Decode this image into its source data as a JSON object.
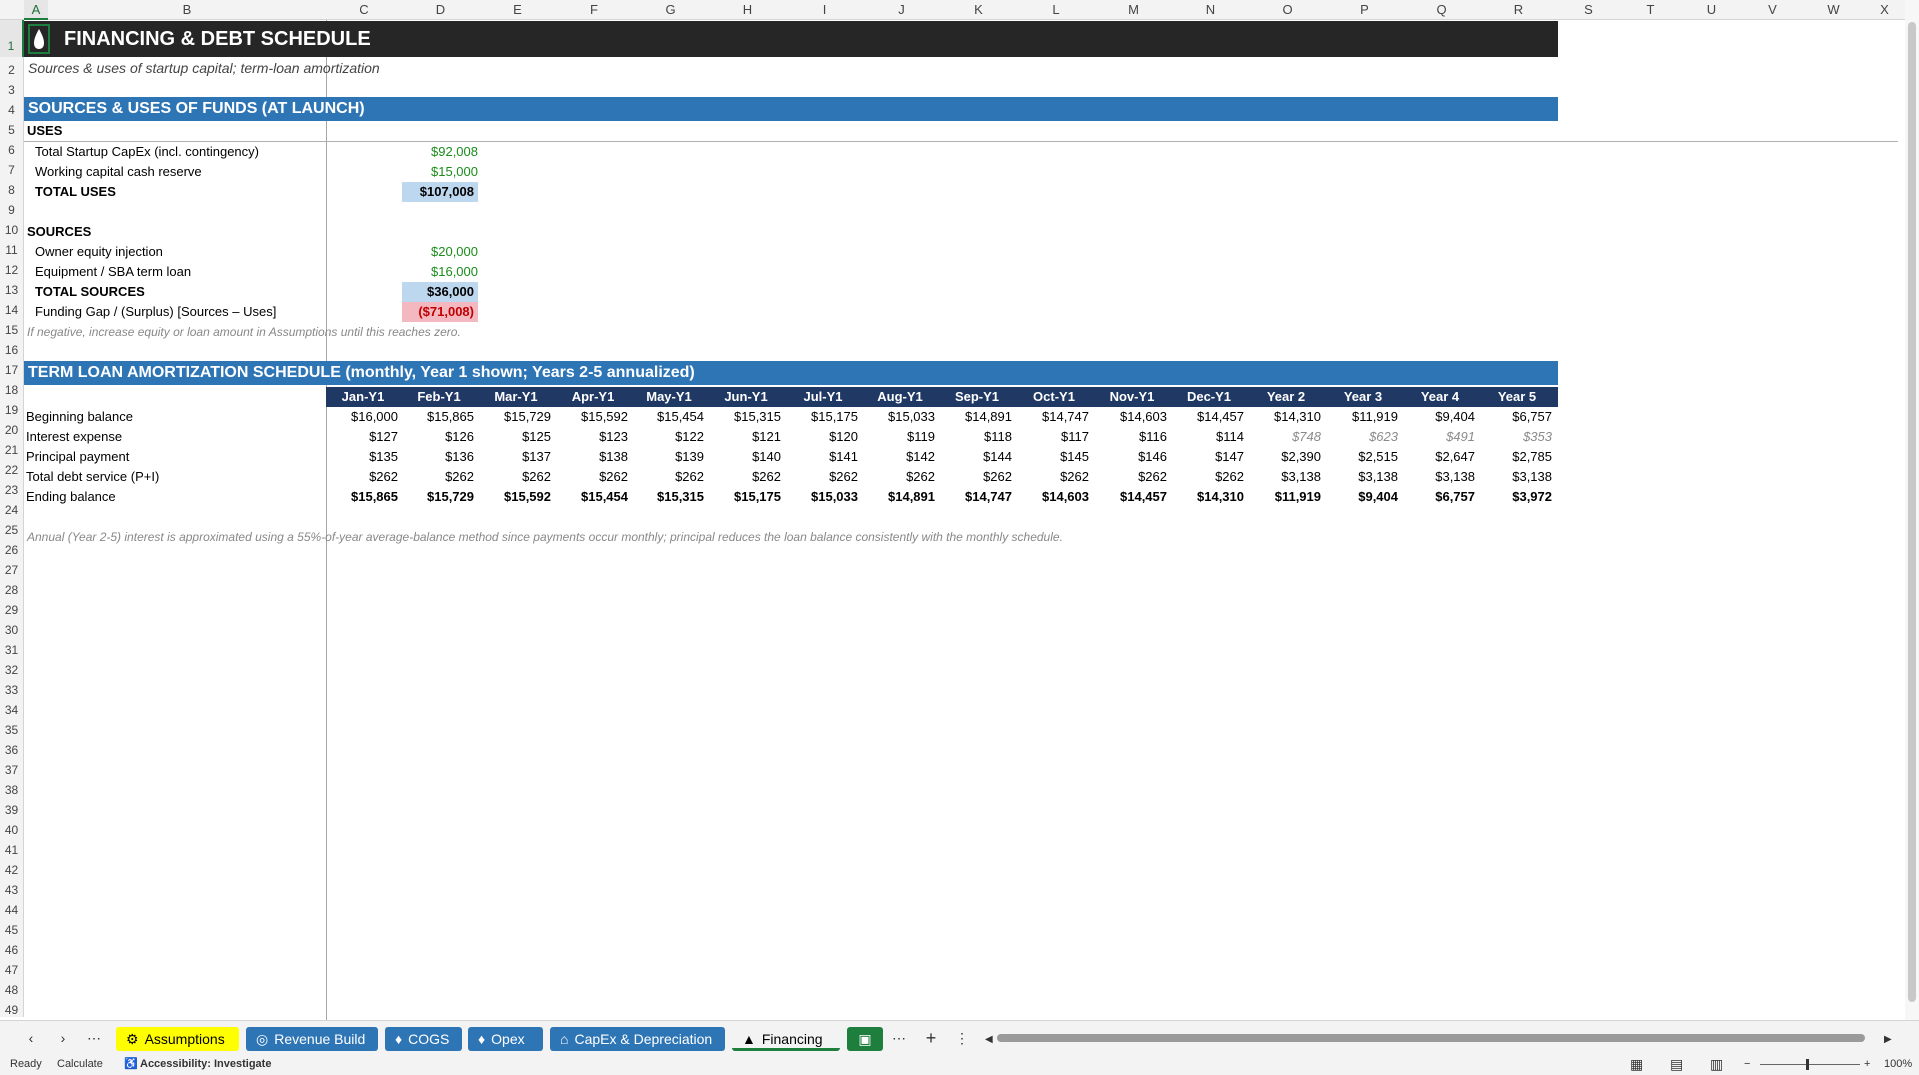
{
  "columns": [
    "A",
    "B",
    "C",
    "D",
    "E",
    "F",
    "G",
    "H",
    "I",
    "J",
    "K",
    "L",
    "M",
    "N",
    "O",
    "P",
    "Q",
    "R",
    "S",
    "T",
    "U",
    "V",
    "W",
    "X"
  ],
  "rows": [
    "1",
    "2",
    "3",
    "4",
    "5",
    "6",
    "7",
    "8",
    "9",
    "10",
    "11",
    "12",
    "13",
    "14",
    "15",
    "16",
    "17",
    "18",
    "19",
    "20",
    "21",
    "22",
    "23",
    "24",
    "25",
    "26",
    "27",
    "28",
    "29",
    "30",
    "31",
    "32",
    "33",
    "34",
    "35",
    "36",
    "37",
    "38",
    "39",
    "40",
    "41",
    "42",
    "43",
    "44",
    "45",
    "46",
    "47",
    "48",
    "49"
  ],
  "sheet": {
    "title": "FINANCING & DEBT SCHEDULE",
    "subtitle": "Sources & uses of startup capital; term-loan amortization",
    "sources_uses_header": "SOURCES & USES OF FUNDS (AT LAUNCH)",
    "uses_label": "USES",
    "uses": [
      {
        "label": "Total Startup CapEx (incl. contingency)",
        "value": "$92,008"
      },
      {
        "label": "Working capital cash reserve",
        "value": "$15,000"
      }
    ],
    "total_uses_label": "TOTAL USES",
    "total_uses_value": "$107,008",
    "sources_label": "SOURCES",
    "sources": [
      {
        "label": "Owner equity injection",
        "value": "$20,000"
      },
      {
        "label": "Equipment / SBA term loan",
        "value": "$16,000"
      }
    ],
    "total_sources_label": "TOTAL SOURCES",
    "total_sources_value": "$36,000",
    "gap_label": "Funding Gap / (Surplus)  [Sources – Uses]",
    "gap_value": "($71,008)",
    "gap_note": "If negative, increase equity or loan amount in Assumptions until this reaches zero.",
    "amort_header": "TERM LOAN AMORTIZATION SCHEDULE  (monthly, Year 1 shown; Years 2-5 annualized)",
    "periods": [
      "Jan-Y1",
      "Feb-Y1",
      "Mar-Y1",
      "Apr-Y1",
      "May-Y1",
      "Jun-Y1",
      "Jul-Y1",
      "Aug-Y1",
      "Sep-Y1",
      "Oct-Y1",
      "Nov-Y1",
      "Dec-Y1",
      "Year 2",
      "Year 3",
      "Year 4",
      "Year 5"
    ],
    "amort_rows": [
      {
        "label": "Beginning balance",
        "values": [
          "$16,000",
          "$15,865",
          "$15,729",
          "$15,592",
          "$15,454",
          "$15,315",
          "$15,175",
          "$15,033",
          "$14,891",
          "$14,747",
          "$14,603",
          "$14,457",
          "$14,310",
          "$11,919",
          "$9,404",
          "$6,757"
        ]
      },
      {
        "label": "Interest expense",
        "values": [
          "$127",
          "$126",
          "$125",
          "$123",
          "$122",
          "$121",
          "$120",
          "$119",
          "$118",
          "$117",
          "$116",
          "$114",
          "$748",
          "$623",
          "$491",
          "$353"
        ]
      },
      {
        "label": "Principal payment",
        "values": [
          "$135",
          "$136",
          "$137",
          "$138",
          "$139",
          "$140",
          "$141",
          "$142",
          "$144",
          "$145",
          "$146",
          "$147",
          "$2,390",
          "$2,515",
          "$2,647",
          "$2,785"
        ]
      },
      {
        "label": "Total debt service (P+I)",
        "values": [
          "$262",
          "$262",
          "$262",
          "$262",
          "$262",
          "$262",
          "$262",
          "$262",
          "$262",
          "$262",
          "$262",
          "$262",
          "$3,138",
          "$3,138",
          "$3,138",
          "$3,138"
        ]
      },
      {
        "label": "Ending balance",
        "values": [
          "$15,865",
          "$15,729",
          "$15,592",
          "$15,454",
          "$15,315",
          "$15,175",
          "$15,033",
          "$14,891",
          "$14,747",
          "$14,603",
          "$14,457",
          "$14,310",
          "$11,919",
          "$9,404",
          "$6,757",
          "$3,972"
        ]
      }
    ],
    "amort_note": "Annual (Year 2-5) interest is approximated using a 55%-of-year average-balance method since payments occur monthly; principal reduces the loan balance consistently with the monthly schedule."
  },
  "tabs": [
    {
      "label": "Assumptions",
      "icon": "gear-icon",
      "bg": "#ffff00",
      "fg": "#000000"
    },
    {
      "label": "Revenue Build",
      "icon": "coin-icon",
      "bg": "#2e75b6",
      "fg": "#ffffff"
    },
    {
      "label": "COGS",
      "icon": "tag-icon",
      "bg": "#2e75b6",
      "fg": "#ffffff"
    },
    {
      "label": "Opex",
      "icon": "tag-icon",
      "bg": "#2e75b6",
      "fg": "#ffffff"
    },
    {
      "label": "CapEx & Depreciation",
      "icon": "building-icon",
      "bg": "#2e75b6",
      "fg": "#ffffff"
    },
    {
      "label": "Financing",
      "icon": "drop-icon",
      "bg": "#f3f3f3",
      "fg": "#000000",
      "active": true
    }
  ],
  "status": {
    "ready": "Ready",
    "calculate": "Calculate",
    "accessibility": "Accessibility: Investigate",
    "zoom": "100%"
  }
}
